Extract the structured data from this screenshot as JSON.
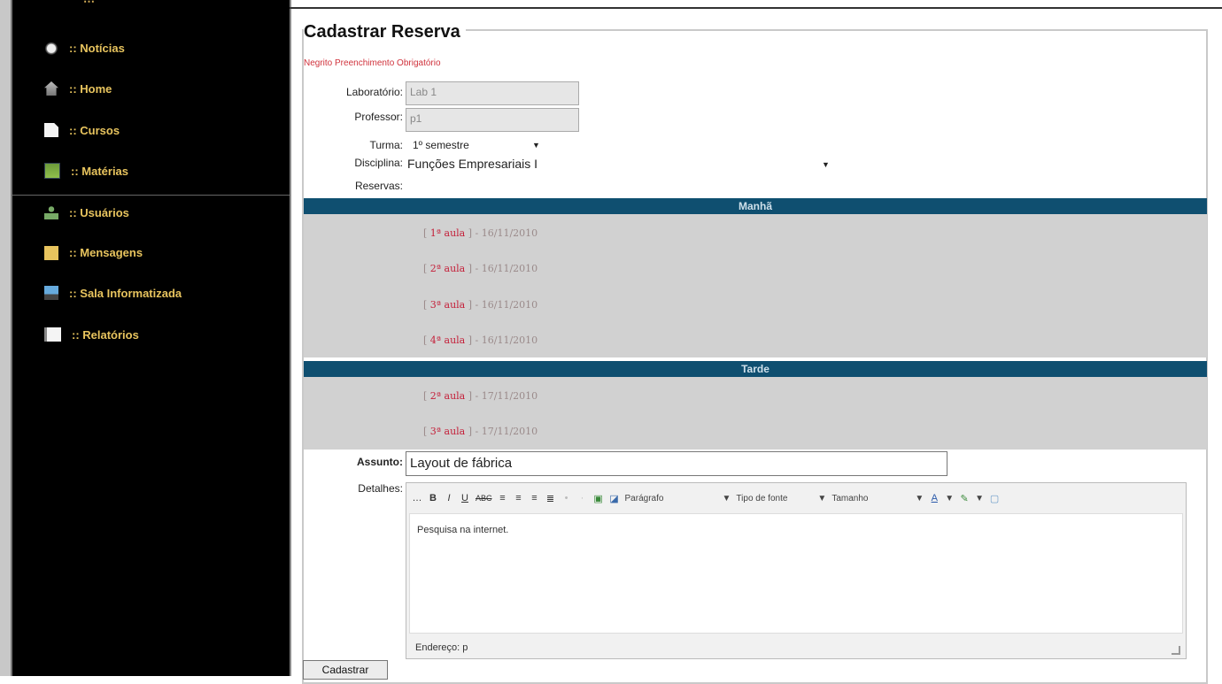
{
  "sidebar": {
    "items": [
      {
        "label": ":: Notícias",
        "icon": "news-icon"
      },
      {
        "label": ":: Home",
        "icon": "home-icon"
      },
      {
        "label": ":: Cursos",
        "icon": "document-icon"
      },
      {
        "label": ":: Matérias",
        "icon": "book-icon"
      },
      {
        "label": ":: Usuários",
        "icon": "user-icon"
      },
      {
        "label": ":: Mensagens",
        "icon": "mail-icon"
      },
      {
        "label": ":: Sala Informatizada",
        "icon": "computer-icon"
      },
      {
        "label": ":: Relatórios",
        "icon": "report-icon"
      }
    ]
  },
  "form": {
    "title": "Cadastrar Reserva",
    "required_note": "Negrito Preenchimento Obrigatório",
    "laboratorio": {
      "label": "Laboratório:",
      "value": "Lab 1"
    },
    "professor": {
      "label": "Professor:",
      "value": "p1"
    },
    "turma": {
      "label": "Turma:",
      "value": "1º semestre"
    },
    "disciplina": {
      "label": "Disciplina:",
      "value": "Funções Empresariais I"
    },
    "reservas_label": "Reservas:",
    "manha": {
      "title": "Manhã",
      "slots": [
        {
          "aula": "1ª aula",
          "date": " - 16/11/2010"
        },
        {
          "aula": "2ª aula",
          "date": " - 16/11/2010"
        },
        {
          "aula": "3ª aula",
          "date": " - 16/11/2010"
        },
        {
          "aula": "4ª aula",
          "date": " - 16/11/2010"
        }
      ]
    },
    "tarde": {
      "title": "Tarde",
      "slots": [
        {
          "aula": "2ª aula",
          "date": " - 17/11/2010"
        },
        {
          "aula": "3ª aula",
          "date": " - 17/11/2010"
        }
      ]
    },
    "assunto": {
      "label": "Assunto:",
      "value": "Layout de fábrica"
    },
    "detalhes": {
      "label": "Detalhes:",
      "content": "Pesquisa na internet.",
      "status": "Endereço: p",
      "toolbar": {
        "paragraph": "Parágrafo",
        "font": "Tipo de fonte",
        "size": "Tamanho"
      }
    },
    "submit_label": "Cadastrar"
  },
  "colors": {
    "sidebar_bg": "#000000",
    "nav_text": "#e8c45e",
    "band": "#0f4f70",
    "required": "#d0323c"
  }
}
